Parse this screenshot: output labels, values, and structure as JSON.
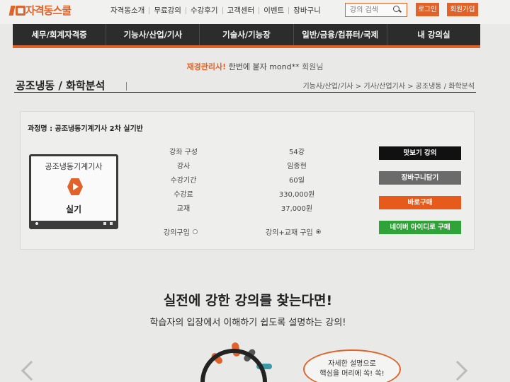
{
  "header": {
    "logo_text": "자격동스쿨",
    "nav": [
      "자격동소개",
      "무료강의",
      "수강후기",
      "고객센터",
      "이벤트",
      "장바구니"
    ],
    "search_placeholder": "강의 검색",
    "login_label": "로그인",
    "join_label": "회원가입"
  },
  "main_nav": [
    "세무/회계자격증",
    "기능사/산업/기사",
    "기술사/기능장",
    "일반/금융/컴퓨터/국제",
    "내 강의실"
  ],
  "welcome": {
    "highlight": "재경관리사!",
    "text": " 한번에 붙자 ",
    "user": "mond**",
    "suffix": " 회원님"
  },
  "page": {
    "title": "공조냉동 / 화학분석",
    "breadcrumb": "기능사/산업/기사 > 기사/산업기사 > 공조냉동 / 화학분석"
  },
  "course": {
    "name": "과정명 : 공조냉동기계기사 2차 실기반",
    "thumb_title": "공조냉동기계기사",
    "thumb_sub": "실기",
    "details": [
      {
        "label": "강좌 구성",
        "value": "54강"
      },
      {
        "label": "강사",
        "value": "임종현"
      },
      {
        "label": "수강기간",
        "value": "60일"
      },
      {
        "label": "수강료",
        "value": "330,000원"
      },
      {
        "label": "교재",
        "value": "37,000원"
      }
    ],
    "option_lecture": "강의구입",
    "option_lecture_book": "강의+교재 구입",
    "selected_option": "강의+교재 구입",
    "buttons": {
      "preview": "맛보기 강의",
      "cart": "장바구니담기",
      "buy": "바로구매",
      "naver": "네이버 아이디로 구매"
    }
  },
  "hero": {
    "headline": "실전에 강한 강의를 찾는다면!",
    "subline": "학습자의 입장에서 이해하기 쉽도록 설명하는 강의!",
    "bubble_line1": "자세한 설명으로",
    "bubble_line2": "핵심을 머리에 쏙! 쏙!"
  },
  "colors": {
    "brand": "#e0632a",
    "nav_bg": "#2c2c2c",
    "naver_green": "#2fa238"
  }
}
